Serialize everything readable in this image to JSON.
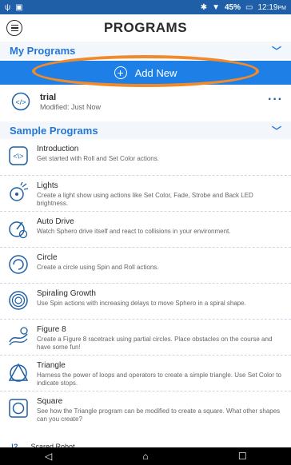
{
  "status_bar": {
    "left_icons": [
      "usb-icon",
      "image-icon"
    ],
    "battery_percent": "45%",
    "time": "12:19",
    "ampm": "PM"
  },
  "app_bar": {
    "title": "PROGRAMS",
    "menu_icon": "menu-icon"
  },
  "my_programs": {
    "header": "My Programs",
    "add_new_label": "Add New",
    "items": [
      {
        "name": "trial",
        "subtitle": "Modified: Just Now",
        "more_icon": "more-options-icon"
      }
    ]
  },
  "sample_programs": {
    "header": "Sample Programs",
    "items": [
      {
        "title": "Introduction",
        "desc": "Get started with Roll and Set Color actions.",
        "icon": "code-icon"
      },
      {
        "title": "Lights",
        "desc": "Create a light show using actions like Set Color, Fade, Strobe and Back LED brightness.",
        "icon": "lights-icon"
      },
      {
        "title": "Auto Drive",
        "desc": "Watch Sphero drive itself and react to collisions in your environment.",
        "icon": "autodrive-icon"
      },
      {
        "title": "Circle",
        "desc": "Create a circle using Spin and Roll actions.",
        "icon": "circle-icon"
      },
      {
        "title": "Spiraling Growth",
        "desc": "Use Spin actions with increasing delays to move Sphero in a spiral shape.",
        "icon": "spiral-icon"
      },
      {
        "title": "Figure 8",
        "desc": "Create a Figure 8 racetrack using partial circles. Place obstacles on the course and have some fun!",
        "icon": "figure8-icon"
      },
      {
        "title": "Triangle",
        "desc": "Harness the power of loops and operators to create a simple triangle. Use Set Color to indicate stops.",
        "icon": "triangle-icon"
      },
      {
        "title": "Square",
        "desc": "See how the Triangle program can be modified to create a square. What other shapes can you create?",
        "icon": "square-icon"
      }
    ],
    "partial_item": {
      "title": "Scared Robot",
      "icon_text": "!?"
    }
  },
  "nav_bar": {
    "back_icon": "back-icon",
    "home_icon": "home-icon",
    "recents_icon": "recents-icon"
  },
  "colors": {
    "primary": "#1e80e6",
    "header_text": "#2377d6",
    "highlight_ring": "#f08a2a"
  }
}
